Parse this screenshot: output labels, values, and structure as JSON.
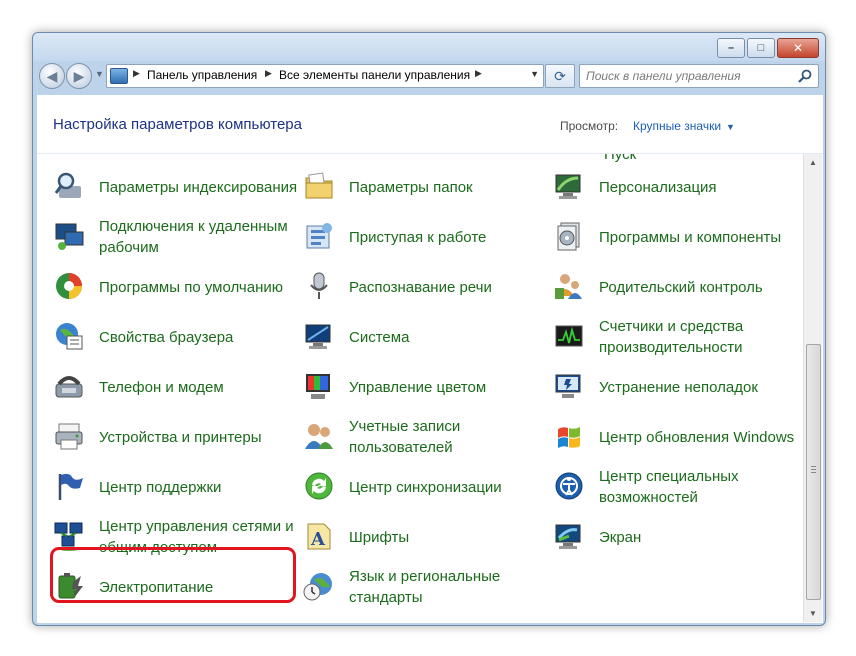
{
  "window": {
    "buttons": {
      "minimize": "–",
      "maximize": "□",
      "close": "✕"
    }
  },
  "navigation": {
    "back_icon": "◀",
    "forward_icon": "▶",
    "breadcrumb": [
      "Панель управления",
      "Все элементы панели управления"
    ],
    "refresh_icon": "⟳"
  },
  "search": {
    "placeholder": "Поиск в панели управления"
  },
  "header": {
    "title": "Настройка параметров компьютера",
    "view_by_label": "Просмотр:",
    "view_by_value": "Крупные значки"
  },
  "partial_top_item": "Пуск",
  "columns": [
    [
      {
        "label": "Параметры индексирования",
        "icon": "indexing-magnifier-icon"
      },
      {
        "label": "Подключения к удаленным рабочим",
        "icon": "remote-desktop-icon"
      },
      {
        "label": "Программы по умолчанию",
        "icon": "default-programs-icon"
      },
      {
        "label": "Свойства браузера",
        "icon": "internet-globe-icon"
      },
      {
        "label": "Телефон и модем",
        "icon": "phone-modem-icon"
      },
      {
        "label": "Устройства и принтеры",
        "icon": "printer-devices-icon"
      },
      {
        "label": "Центр поддержки",
        "icon": "action-center-flag-icon"
      },
      {
        "label": "Центр управления сетями и общим доступом",
        "icon": "network-sharing-icon"
      },
      {
        "label": "Электропитание",
        "icon": "power-battery-icon"
      }
    ],
    [
      {
        "label": "Параметры папок",
        "icon": "folder-options-icon"
      },
      {
        "label": "Приступая к работе",
        "icon": "getting-started-icon"
      },
      {
        "label": "Распознавание речи",
        "icon": "microphone-icon"
      },
      {
        "label": "Система",
        "icon": "system-monitor-icon"
      },
      {
        "label": "Управление цветом",
        "icon": "color-management-icon"
      },
      {
        "label": "Учетные записи пользователей",
        "icon": "user-accounts-icon"
      },
      {
        "label": "Центр синхронизации",
        "icon": "sync-center-icon"
      },
      {
        "label": "Шрифты",
        "icon": "fonts-icon"
      },
      {
        "label": "Язык и региональные стандарты",
        "icon": "region-clock-icon"
      }
    ],
    [
      {
        "label": "Персонализация",
        "icon": "personalization-icon"
      },
      {
        "label": "Программы и компоненты",
        "icon": "programs-features-icon"
      },
      {
        "label": "Родительский контроль",
        "icon": "parental-control-icon"
      },
      {
        "label": "Счетчики и средства производительности",
        "icon": "performance-icon"
      },
      {
        "label": "Устранение неполадок",
        "icon": "troubleshooting-icon"
      },
      {
        "label": "Центр обновления Windows",
        "icon": "windows-update-icon"
      },
      {
        "label": "Центр специальных возможностей",
        "icon": "ease-of-access-icon"
      },
      {
        "label": "Экран",
        "icon": "display-icon"
      }
    ]
  ],
  "highlighted_item": "Центр управления сетями и общим доступом",
  "colors": {
    "link_green": "#1c6b1c",
    "title_blue": "#1e3287",
    "highlight_red": "#e0151f"
  }
}
